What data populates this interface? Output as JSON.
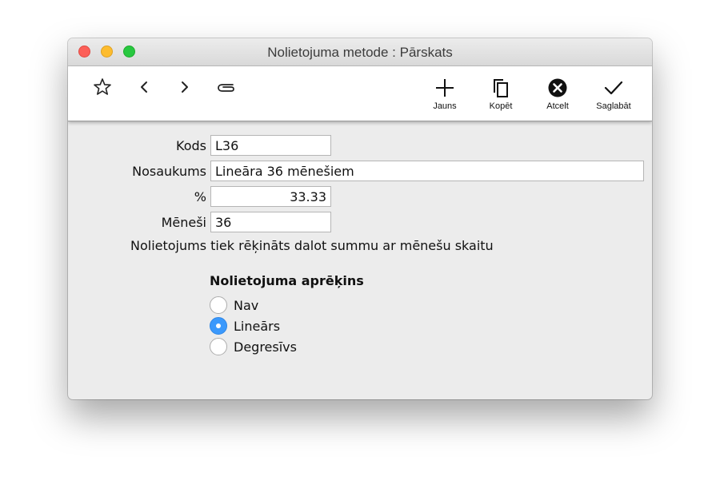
{
  "window": {
    "title": "Nolietojuma metode : Pārskats"
  },
  "toolbar": {
    "icons": [
      "star-icon",
      "chevron-left-icon",
      "chevron-right-icon",
      "paperclip-icon"
    ],
    "new_label": "Jauns",
    "copy_label": "Kopēt",
    "cancel_label": "Atcelt",
    "save_label": "Saglabāt"
  },
  "form": {
    "kods_label": "Kods",
    "kods_value": "L36",
    "nosaukums_label": "Nosaukums",
    "nosaukums_value": "Lineāra 36 mēnešiem",
    "percent_label": "%",
    "percent_value": "33.33",
    "menesi_label": "Mēneši",
    "menesi_value": "36",
    "note": "Nolietojums tiek rēķināts dalot summu ar mēnešu skaitu"
  },
  "calculation": {
    "title": "Nolietojuma aprēķins",
    "options": [
      {
        "label": "Nav",
        "selected": false
      },
      {
        "label": "Lineārs",
        "selected": true
      },
      {
        "label": "Degresīvs",
        "selected": false
      }
    ]
  },
  "colors": {
    "accent": "#3b99fc",
    "close": "#fc5f58",
    "minimize": "#fdbc2e",
    "maximize": "#28c840"
  }
}
